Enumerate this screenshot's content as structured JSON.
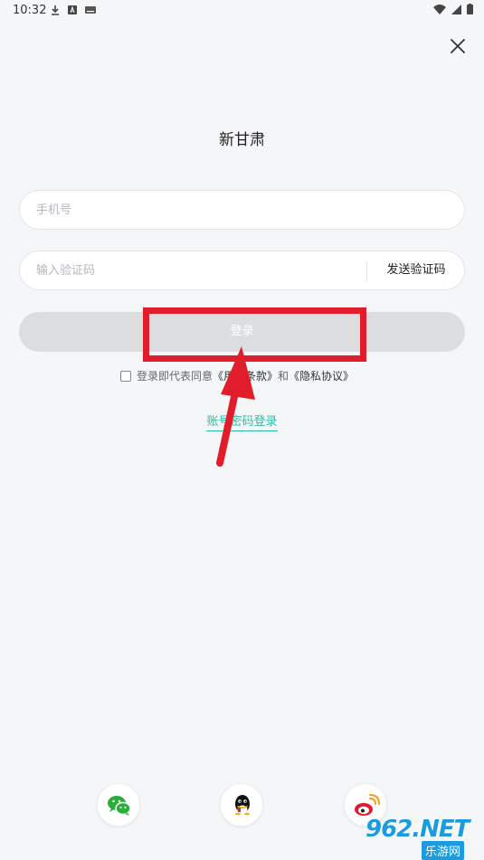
{
  "status_bar": {
    "time": "10:32"
  },
  "title": "新甘肃",
  "phone_field": {
    "placeholder": "手机号"
  },
  "code_field": {
    "placeholder": "输入验证码",
    "send_code_label": "发送验证码"
  },
  "login_button": {
    "label": "登录"
  },
  "agreement": {
    "prefix": "登录即代表同意",
    "terms_link": "《用户条款》",
    "and": "和",
    "privacy_link": "《隐私协议》"
  },
  "password_login_link": "账号密码登录",
  "social_logins": [
    "wechat-icon",
    "qq-icon",
    "weibo-icon"
  ],
  "colors": {
    "accent": "#2bbfa5",
    "highlight": "#e11d2b",
    "wechat": "#2aae3a"
  },
  "watermark": {
    "brand": "962.NET",
    "sub": "乐游网"
  }
}
